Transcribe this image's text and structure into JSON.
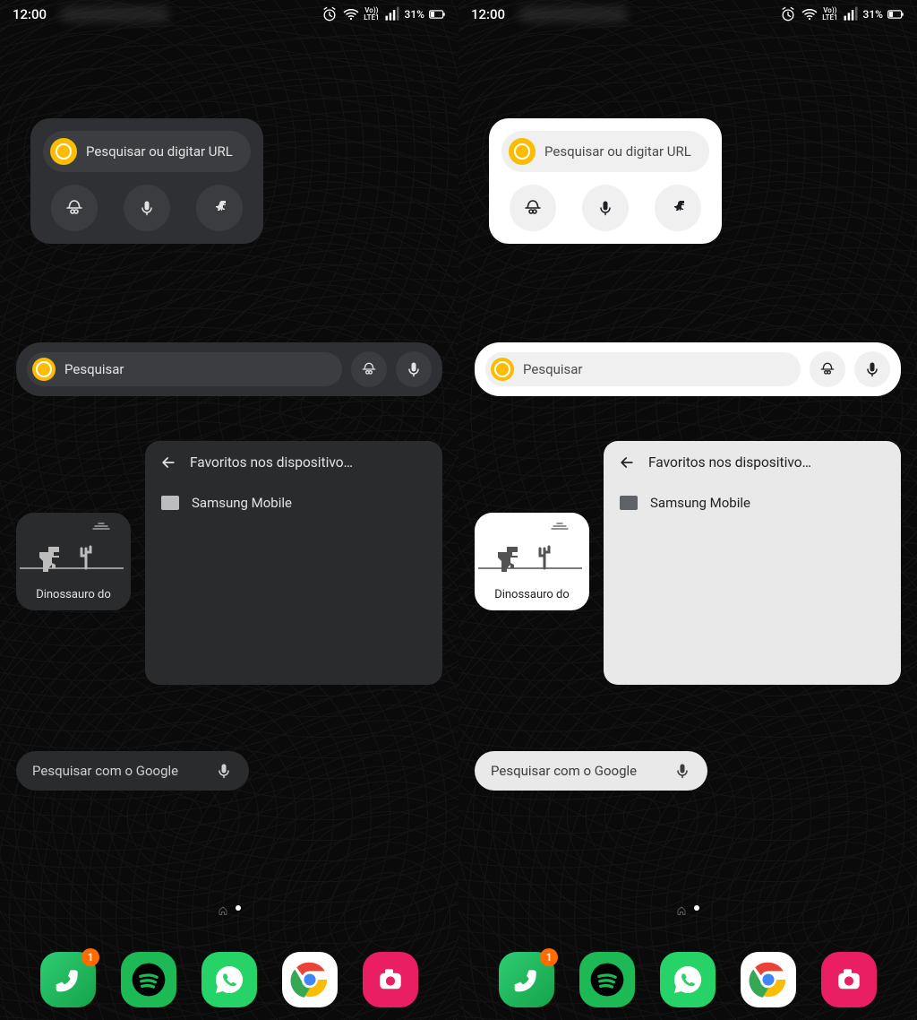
{
  "status": {
    "time": "12:00",
    "network": "LTE1",
    "volte": "Vo))",
    "battery_text": "31%"
  },
  "chrome_widget": {
    "search_placeholder": "Pesquisar ou digitar URL"
  },
  "wide_search": {
    "placeholder": "Pesquisar"
  },
  "dino": {
    "label": "Dinossauro do"
  },
  "bookmarks": {
    "title": "Favoritos nos dispositivo…",
    "folder": "Samsung Mobile"
  },
  "google_pill": {
    "placeholder": "Pesquisar com o Google"
  },
  "dock": {
    "phone_badge": "1"
  }
}
